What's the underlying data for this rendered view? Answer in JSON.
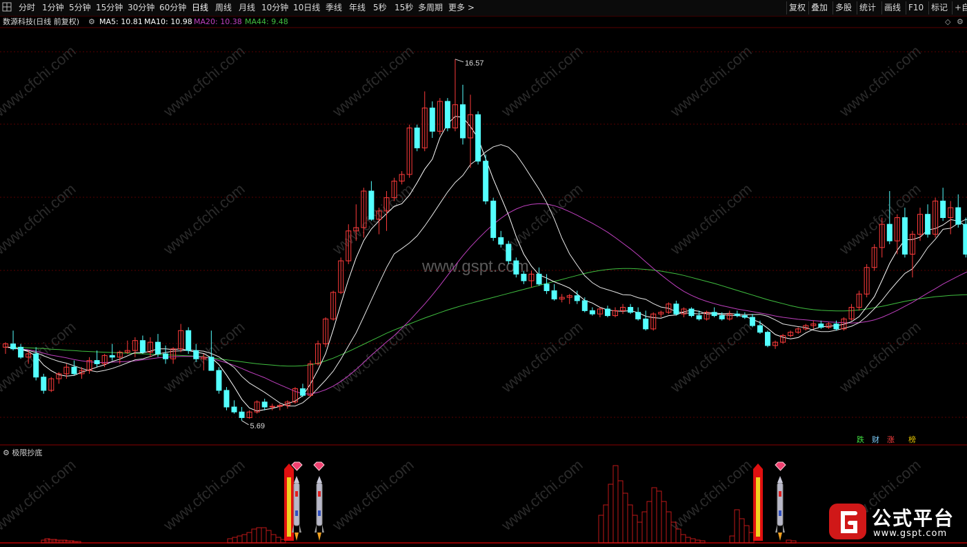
{
  "toolbar": {
    "period_buttons": [
      "分时",
      "1分钟",
      "5分钟",
      "15分钟",
      "30分钟",
      "60分钟",
      "日线",
      "周线",
      "月线",
      "10分钟",
      "10日线",
      "季线",
      "年线",
      "5秒",
      "15秒",
      "多周期",
      "更多 >"
    ],
    "right_buttons": [
      "复权",
      "叠加",
      "多股",
      "统计",
      "画线",
      "F10",
      "标记",
      "+自"
    ],
    "active": "日线"
  },
  "stock": {
    "title": "数源科技(日线 前复权)",
    "ma5_label": "MA5: 10.81",
    "ma10_label": "MA10: 10.98",
    "ma20_label": "MA20: 10.38",
    "ma44_label": "MA44: 9.48"
  },
  "annotations": {
    "high_label": "16.57",
    "low_label": "5.69"
  },
  "indicator": {
    "title": "极限抄底"
  },
  "legend_chips": [
    "跌",
    "财",
    "涨",
    "榜"
  ],
  "watermark": {
    "center": "www.gspt.com",
    "tile": "www.cfchi.com",
    "logo_cn": "公式平台",
    "logo_en": "www.gspt.com"
  },
  "colors": {
    "up": "#ff3b3b",
    "down": "#54ffff",
    "ma5": "#ffffff",
    "ma10": "#e8e8e8",
    "ma20": "#c040c0",
    "ma44": "#40c040",
    "grid": "#5a0000"
  },
  "chart_data": {
    "type": "candlestick",
    "price_high": 16.57,
    "price_low": 5.69,
    "y_range": [
      5.0,
      17.5
    ],
    "candles": [
      [
        7.9,
        8.05,
        7.7,
        8.0
      ],
      [
        8.0,
        8.4,
        7.8,
        7.85
      ],
      [
        7.9,
        8.0,
        7.55,
        7.6
      ],
      [
        7.6,
        7.8,
        7.4,
        7.7
      ],
      [
        7.7,
        7.9,
        6.9,
        7.0
      ],
      [
        7.0,
        7.1,
        6.5,
        6.6
      ],
      [
        6.6,
        7.0,
        6.55,
        6.95
      ],
      [
        6.95,
        7.15,
        6.8,
        7.1
      ],
      [
        7.1,
        7.4,
        6.95,
        7.3
      ],
      [
        7.3,
        7.5,
        7.05,
        7.1
      ],
      [
        7.1,
        7.3,
        6.95,
        7.2
      ],
      [
        7.2,
        7.6,
        7.1,
        7.5
      ],
      [
        7.5,
        7.8,
        7.3,
        7.4
      ],
      [
        7.4,
        7.7,
        7.3,
        7.65
      ],
      [
        7.65,
        8.0,
        7.5,
        7.6
      ],
      [
        7.6,
        7.8,
        7.4,
        7.75
      ],
      [
        7.75,
        8.1,
        7.7,
        7.8
      ],
      [
        7.8,
        8.2,
        7.6,
        8.1
      ],
      [
        8.1,
        8.25,
        7.7,
        7.75
      ],
      [
        7.75,
        8.2,
        7.6,
        8.05
      ],
      [
        8.05,
        8.3,
        7.6,
        7.7
      ],
      [
        7.7,
        7.95,
        7.4,
        7.55
      ],
      [
        7.55,
        7.9,
        7.4,
        7.85
      ],
      [
        7.85,
        8.6,
        7.75,
        8.4
      ],
      [
        8.4,
        8.5,
        7.7,
        7.8
      ],
      [
        7.8,
        8.0,
        7.45,
        7.55
      ],
      [
        7.55,
        7.7,
        7.2,
        7.6
      ],
      [
        7.6,
        8.4,
        7.5,
        7.2
      ],
      [
        7.2,
        7.3,
        6.5,
        6.6
      ],
      [
        6.6,
        6.7,
        6.0,
        6.1
      ],
      [
        6.1,
        6.3,
        5.9,
        5.95
      ],
      [
        5.95,
        6.1,
        5.69,
        5.78
      ],
      [
        5.78,
        6.0,
        5.75,
        5.95
      ],
      [
        5.95,
        6.3,
        5.9,
        6.25
      ],
      [
        6.25,
        6.35,
        6.0,
        6.1
      ],
      [
        6.1,
        6.2,
        6.0,
        6.12
      ],
      [
        6.12,
        6.2,
        6.0,
        6.15
      ],
      [
        6.15,
        6.3,
        6.05,
        6.25
      ],
      [
        6.25,
        6.7,
        6.2,
        6.65
      ],
      [
        6.65,
        6.8,
        6.4,
        6.45
      ],
      [
        6.45,
        7.5,
        6.4,
        7.4
      ],
      [
        7.4,
        8.1,
        7.35,
        8.0
      ],
      [
        8.0,
        8.8,
        7.9,
        8.75
      ],
      [
        8.75,
        9.6,
        8.7,
        9.55
      ],
      [
        9.55,
        10.6,
        9.5,
        10.5
      ],
      [
        10.5,
        11.6,
        10.4,
        11.4
      ],
      [
        11.4,
        12.2,
        11.1,
        11.5
      ],
      [
        11.5,
        12.7,
        11.2,
        12.6
      ],
      [
        12.6,
        12.9,
        11.7,
        11.75
      ],
      [
        11.75,
        12.1,
        11.3,
        12.0
      ],
      [
        12.0,
        12.6,
        11.4,
        12.4
      ],
      [
        12.4,
        13.0,
        12.3,
        12.9
      ],
      [
        12.9,
        13.2,
        12.8,
        13.1
      ],
      [
        13.1,
        14.6,
        13.0,
        14.5
      ],
      [
        14.5,
        14.6,
        13.8,
        13.9
      ],
      [
        13.9,
        15.6,
        13.8,
        15.1
      ],
      [
        15.1,
        15.3,
        14.2,
        14.4
      ],
      [
        14.4,
        15.4,
        14.3,
        15.3
      ],
      [
        15.3,
        15.4,
        14.4,
        14.5
      ],
      [
        14.5,
        16.57,
        14.4,
        15.2
      ],
      [
        15.2,
        15.8,
        14.0,
        14.2
      ],
      [
        14.2,
        15.5,
        13.3,
        14.9
      ],
      [
        14.9,
        15.0,
        13.4,
        13.5
      ],
      [
        13.5,
        13.7,
        12.2,
        12.3
      ],
      [
        12.3,
        12.4,
        11.1,
        11.2
      ],
      [
        11.2,
        11.4,
        10.9,
        11.0
      ],
      [
        11.0,
        11.1,
        10.4,
        10.5
      ],
      [
        10.5,
        10.6,
        10.0,
        10.1
      ],
      [
        10.1,
        10.2,
        9.8,
        9.9
      ],
      [
        9.9,
        10.2,
        9.7,
        10.1
      ],
      [
        10.1,
        10.3,
        9.75,
        9.8
      ],
      [
        9.8,
        10.1,
        9.5,
        9.6
      ],
      [
        9.6,
        9.8,
        9.3,
        9.35
      ],
      [
        9.35,
        9.5,
        9.25,
        9.4
      ],
      [
        9.4,
        9.5,
        9.2,
        9.45
      ],
      [
        9.45,
        9.6,
        9.2,
        9.3
      ],
      [
        9.3,
        9.4,
        8.95,
        9.0
      ],
      [
        9.0,
        9.1,
        8.85,
        8.9
      ],
      [
        8.9,
        9.1,
        8.8,
        9.05
      ],
      [
        9.05,
        9.15,
        8.8,
        8.85
      ],
      [
        8.85,
        9.1,
        8.8,
        9.0
      ],
      [
        9.0,
        9.2,
        8.9,
        9.1
      ],
      [
        9.1,
        9.2,
        8.9,
        8.95
      ],
      [
        8.95,
        9.1,
        8.7,
        8.75
      ],
      [
        8.75,
        9.0,
        8.4,
        8.45
      ],
      [
        8.45,
        8.95,
        8.4,
        8.9
      ],
      [
        8.9,
        9.0,
        8.8,
        8.95
      ],
      [
        8.95,
        9.25,
        8.9,
        9.2
      ],
      [
        9.2,
        9.3,
        8.85,
        8.9
      ],
      [
        8.9,
        9.1,
        8.8,
        9.05
      ],
      [
        9.05,
        9.1,
        8.8,
        8.85
      ],
      [
        8.85,
        9.0,
        8.7,
        8.75
      ],
      [
        8.75,
        9.0,
        8.7,
        8.95
      ],
      [
        8.95,
        9.1,
        8.8,
        8.85
      ],
      [
        8.85,
        8.95,
        8.7,
        8.75
      ],
      [
        8.75,
        9.0,
        8.7,
        8.9
      ],
      [
        8.9,
        9.0,
        8.8,
        8.85
      ],
      [
        8.85,
        8.95,
        8.75,
        8.8
      ],
      [
        8.8,
        8.9,
        8.5,
        8.55
      ],
      [
        8.55,
        8.7,
        8.3,
        8.35
      ],
      [
        8.35,
        8.4,
        7.9,
        7.95
      ],
      [
        7.95,
        8.1,
        7.85,
        8.05
      ],
      [
        8.05,
        8.3,
        8.0,
        8.25
      ],
      [
        8.25,
        8.4,
        8.2,
        8.35
      ],
      [
        8.35,
        8.5,
        8.3,
        8.45
      ],
      [
        8.45,
        8.6,
        8.4,
        8.55
      ],
      [
        8.55,
        8.7,
        8.45,
        8.6
      ],
      [
        8.6,
        8.7,
        8.45,
        8.5
      ],
      [
        8.5,
        8.65,
        8.45,
        8.6
      ],
      [
        8.6,
        8.7,
        8.4,
        8.45
      ],
      [
        8.45,
        8.8,
        8.4,
        8.75
      ],
      [
        8.75,
        9.2,
        8.7,
        9.1
      ],
      [
        9.1,
        9.6,
        9.0,
        9.5
      ],
      [
        9.5,
        10.4,
        9.4,
        10.3
      ],
      [
        10.3,
        11.0,
        10.2,
        10.9
      ],
      [
        10.9,
        11.8,
        10.6,
        11.6
      ],
      [
        11.6,
        12.6,
        11.0,
        11.1
      ],
      [
        11.1,
        11.9,
        10.7,
        11.8
      ],
      [
        11.8,
        12.1,
        10.6,
        10.7
      ],
      [
        10.7,
        11.4,
        10.0,
        11.3
      ],
      [
        11.3,
        12.1,
        11.1,
        11.9
      ],
      [
        11.9,
        12.2,
        11.2,
        11.3
      ],
      [
        11.3,
        12.4,
        11.2,
        12.3
      ],
      [
        12.3,
        12.7,
        11.7,
        11.8
      ],
      [
        11.8,
        12.3,
        11.3,
        12.1
      ],
      [
        12.1,
        12.5,
        11.5,
        11.6
      ],
      [
        11.6,
        11.8,
        10.6,
        10.7
      ],
      [
        10.7,
        11.2,
        10.5,
        11.0
      ]
    ],
    "ma5": [
      7.9,
      7.88,
      7.83,
      7.77,
      7.63,
      7.36,
      7.19,
      7.07,
      7.03,
      7.05,
      7.15,
      7.22,
      7.3,
      7.37,
      7.47,
      7.54,
      7.64,
      7.74,
      7.73,
      7.78,
      7.85,
      7.85,
      7.83,
      7.85,
      7.8,
      7.75,
      7.71,
      7.58,
      7.38,
      7.06,
      6.71,
      6.33,
      6.07,
      5.98,
      6.02,
      6.06,
      6.12,
      6.2,
      6.28,
      6.44,
      6.79,
      7.22,
      7.71,
      8.43,
      9.2,
      9.94,
      10.59,
      11.11,
      11.46,
      11.7,
      11.92,
      12.14,
      12.22,
      12.48,
      12.85,
      13.26,
      13.56,
      14.21,
      14.62,
      14.85,
      14.82,
      14.54,
      14.19,
      13.57,
      12.96,
      12.42,
      11.88,
      11.23,
      10.7,
      10.34,
      10.08,
      9.98,
      9.87,
      9.78,
      9.68,
      9.5,
      9.31,
      9.23,
      9.1,
      9.02,
      8.99,
      8.98,
      9.0,
      8.94,
      8.83,
      8.79,
      8.77,
      8.85,
      8.87,
      8.97,
      9.01,
      8.98,
      8.9,
      8.91,
      8.88,
      8.86,
      8.85,
      8.83,
      8.74,
      8.64,
      8.47,
      8.28,
      8.2,
      8.15,
      8.19,
      8.33,
      8.44,
      8.51,
      8.53,
      8.55,
      8.59,
      8.67,
      8.82,
      9.12,
      9.42,
      9.91,
      10.42,
      10.82,
      11.13,
      11.14,
      11.21,
      11.43,
      11.47,
      11.58,
      11.74,
      11.7,
      11.54,
      11.41
    ],
    "ma10": [
      7.9,
      7.88,
      7.84,
      7.8,
      7.74,
      7.64,
      7.55,
      7.47,
      7.42,
      7.34,
      7.26,
      7.2,
      7.16,
      7.2,
      7.26,
      7.34,
      7.43,
      7.52,
      7.55,
      7.62,
      7.7,
      7.74,
      7.78,
      7.79,
      7.82,
      7.8,
      7.78,
      7.71,
      7.61,
      7.45,
      7.29,
      7.02,
      6.82,
      6.68,
      6.54,
      6.38,
      6.22,
      6.13,
      6.13,
      6.23,
      6.42,
      6.67,
      6.91,
      7.18,
      7.54,
      7.94,
      8.33,
      8.82,
      9.32,
      9.82,
      10.3,
      10.71,
      10.87,
      11.04,
      11.25,
      11.55,
      11.88,
      12.23,
      12.57,
      12.86,
      13.07,
      13.4,
      13.57,
      13.78,
      13.93,
      14.0,
      13.92,
      13.7,
      13.37,
      13.01,
      12.66,
      12.25,
      11.76,
      11.18,
      10.71,
      10.37,
      10.05,
      9.84,
      9.7,
      9.63,
      9.56,
      9.48,
      9.47,
      9.39,
      9.34,
      9.21,
      9.11,
      9.07,
      8.97,
      8.93,
      8.92,
      8.9,
      8.94,
      8.93,
      8.91,
      8.92,
      8.89,
      8.88,
      8.88,
      8.89,
      8.83,
      8.72,
      8.6,
      8.56,
      8.52,
      8.49,
      8.41,
      8.37,
      8.37,
      8.41,
      8.47,
      8.53,
      8.64,
      8.83,
      9.06,
      9.31,
      9.6,
      9.87,
      10.12,
      10.26,
      10.55,
      10.9,
      11.15,
      11.45,
      11.48,
      11.63,
      11.75,
      11.65
    ],
    "ma20": [
      7.9,
      7.88,
      7.85,
      7.82,
      7.78,
      7.72,
      7.66,
      7.62,
      7.58,
      7.53,
      7.49,
      7.46,
      7.44,
      7.44,
      7.45,
      7.46,
      7.47,
      7.49,
      7.52,
      7.55,
      7.58,
      7.6,
      7.61,
      7.62,
      7.62,
      7.62,
      7.6,
      7.56,
      7.5,
      7.43,
      7.35,
      7.26,
      7.16,
      7.07,
      6.98,
      6.87,
      6.77,
      6.67,
      6.57,
      6.5,
      6.49,
      6.54,
      6.62,
      6.73,
      6.87,
      7.04,
      7.23,
      7.44,
      7.66,
      7.86,
      8.06,
      8.25,
      8.47,
      8.7,
      8.95,
      9.2,
      9.47,
      9.76,
      10.06,
      10.36,
      10.65,
      10.92,
      11.16,
      11.39,
      11.6,
      11.78,
      11.94,
      12.06,
      12.15,
      12.2,
      12.22,
      12.21,
      12.16,
      12.08,
      11.98,
      11.87,
      11.75,
      11.63,
      11.5,
      11.36,
      11.2,
      11.03,
      10.86,
      10.67,
      10.47,
      10.27,
      10.08,
      9.9,
      9.73,
      9.58,
      9.46,
      9.36,
      9.28,
      9.21,
      9.15,
      9.1,
      9.05,
      9.01,
      8.97,
      8.93,
      8.89,
      8.84,
      8.8,
      8.77,
      8.74,
      8.72,
      8.7,
      8.68,
      8.66,
      8.65,
      8.64,
      8.63,
      8.64,
      8.67,
      8.72,
      8.8,
      8.9,
      9.01,
      9.13,
      9.25,
      9.39,
      9.53,
      9.66,
      9.8,
      9.92,
      10.04,
      10.15,
      10.25
    ],
    "ma44": [
      7.9,
      7.9,
      7.89,
      7.88,
      7.87,
      7.86,
      7.84,
      7.83,
      7.81,
      7.8,
      7.78,
      7.77,
      7.76,
      7.75,
      7.74,
      7.73,
      7.72,
      7.71,
      7.7,
      7.69,
      7.68,
      7.67,
      7.66,
      7.65,
      7.64,
      7.63,
      7.61,
      7.58,
      7.55,
      7.52,
      7.49,
      7.46,
      7.43,
      7.4,
      7.38,
      7.36,
      7.34,
      7.33,
      7.33,
      7.34,
      7.37,
      7.42,
      7.49,
      7.57,
      7.67,
      7.77,
      7.88,
      7.99,
      8.1,
      8.21,
      8.32,
      8.42,
      8.51,
      8.6,
      8.69,
      8.78,
      8.86,
      8.94,
      9.02,
      9.09,
      9.16,
      9.22,
      9.28,
      9.34,
      9.4,
      9.46,
      9.52,
      9.58,
      9.64,
      9.7,
      9.76,
      9.82,
      9.88,
      9.94,
      10.0,
      10.06,
      10.12,
      10.17,
      10.21,
      10.24,
      10.26,
      10.27,
      10.27,
      10.26,
      10.24,
      10.22,
      10.19,
      10.15,
      10.11,
      10.06,
      10.0,
      9.94,
      9.88,
      9.82,
      9.75,
      9.68,
      9.61,
      9.54,
      9.47,
      9.4,
      9.33,
      9.27,
      9.21,
      9.15,
      9.1,
      9.06,
      9.03,
      9.01,
      9.0,
      8.99,
      8.99,
      9.0,
      9.02,
      9.05,
      9.09,
      9.13,
      9.18,
      9.23,
      9.28,
      9.32,
      9.36,
      9.39,
      9.42,
      9.44,
      9.46,
      9.47,
      9.48,
      9.48
    ],
    "indicator_bars": [
      [
        60,
        4
      ],
      [
        65,
        6
      ],
      [
        70,
        5
      ],
      [
        75,
        5
      ],
      [
        80,
        4
      ],
      [
        85,
        4
      ],
      [
        90,
        4
      ],
      [
        95,
        3
      ],
      [
        100,
        3
      ],
      [
        105,
        2
      ],
      [
        110,
        2
      ],
      [
        330,
        6
      ],
      [
        337,
        8
      ],
      [
        344,
        10
      ],
      [
        351,
        12
      ],
      [
        358,
        15
      ],
      [
        365,
        20
      ],
      [
        372,
        22
      ],
      [
        379,
        22
      ],
      [
        386,
        18
      ],
      [
        393,
        12
      ],
      [
        400,
        8
      ],
      [
        407,
        5
      ],
      [
        868,
        40
      ],
      [
        875,
        55
      ],
      [
        882,
        85
      ],
      [
        889,
        112
      ],
      [
        896,
        90
      ],
      [
        903,
        72
      ],
      [
        910,
        55
      ],
      [
        917,
        40
      ],
      [
        924,
        30
      ],
      [
        931,
        45
      ],
      [
        938,
        60
      ],
      [
        945,
        80
      ],
      [
        952,
        75
      ],
      [
        959,
        60
      ],
      [
        966,
        45
      ],
      [
        973,
        30
      ],
      [
        980,
        20
      ],
      [
        987,
        12
      ],
      [
        994,
        8
      ],
      [
        1001,
        6
      ],
      [
        1008,
        4
      ],
      [
        1015,
        3
      ],
      [
        1058,
        10
      ],
      [
        1065,
        48
      ],
      [
        1072,
        35
      ],
      [
        1079,
        25
      ],
      [
        1086,
        15
      ],
      [
        1140,
        4
      ],
      [
        1147,
        3
      ]
    ]
  }
}
